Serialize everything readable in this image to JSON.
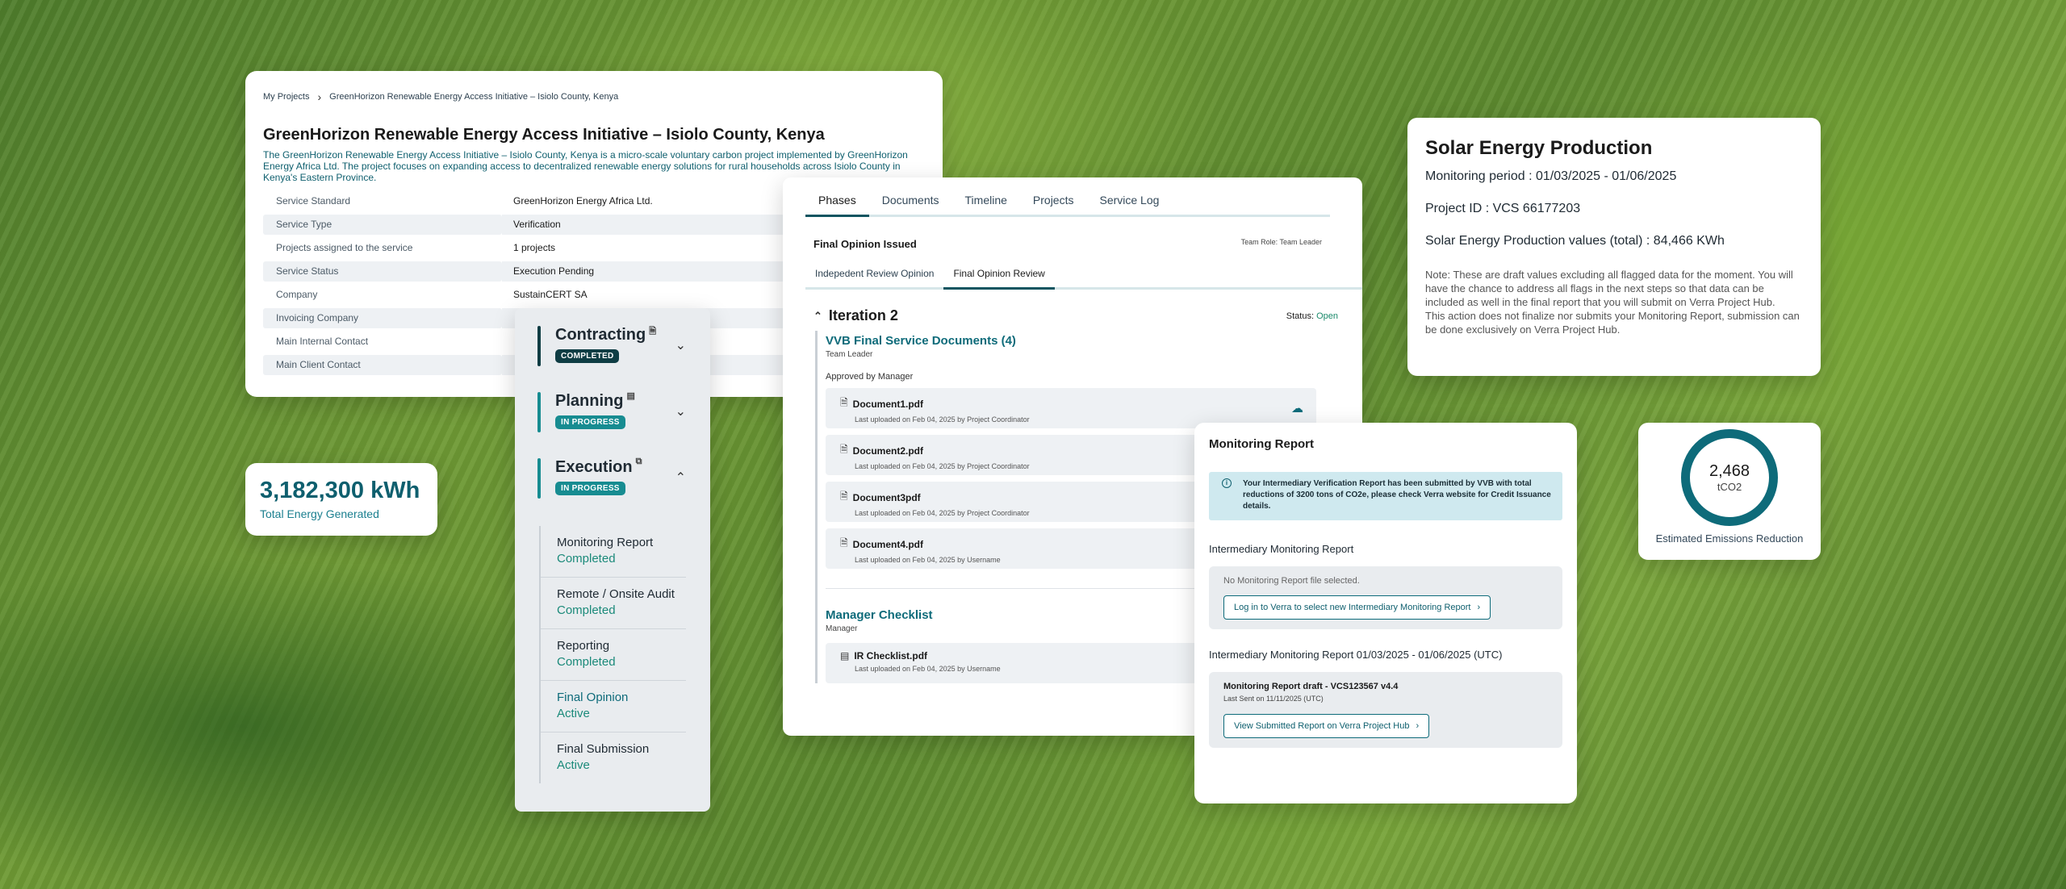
{
  "project": {
    "breadcrumb": [
      "My Projects",
      "GreenHorizon Renewable Energy Access Initiative – Isiolo County, Kenya"
    ],
    "title": "GreenHorizon Renewable Energy Access Initiative – Isiolo County, Kenya",
    "description": "The GreenHorizon Renewable Energy Access Initiative – Isiolo County, Kenya is a micro-scale voluntary carbon project implemented by GreenHorizon Energy Africa Ltd. The project focuses on expanding access to decentralized renewable energy solutions for rural households across Isiolo County in Kenya's Eastern Province.",
    "rows": [
      {
        "k": "Service Standard",
        "v": "GreenHorizon Energy Africa Ltd."
      },
      {
        "k": "Service Type",
        "v": "Verification"
      },
      {
        "k": "Projects assigned to the service",
        "v": "1 projects"
      },
      {
        "k": "Service Status",
        "v": "Execution Pending"
      },
      {
        "k": "Company",
        "v": "SustainCERT SA"
      },
      {
        "k": "Invoicing Company",
        "v": ""
      },
      {
        "k": "Main Internal Contact",
        "v": ""
      },
      {
        "k": "Main Client Contact",
        "v": ""
      }
    ]
  },
  "energy": {
    "value": "3,182,300 kWh",
    "label": "Total Energy Generated"
  },
  "phases": {
    "contracting": {
      "name": "Contracting",
      "badge": "COMPLETED"
    },
    "planning": {
      "name": "Planning",
      "badge": "IN PROGRESS"
    },
    "execution": {
      "name": "Execution",
      "badge": "IN PROGRESS"
    },
    "steps": [
      {
        "t": "Monitoring Report",
        "s": "Completed"
      },
      {
        "t": "Remote / Onsite Audit",
        "s": "Completed"
      },
      {
        "t": "Reporting",
        "s": "Completed"
      },
      {
        "t": "Final Opinion",
        "s": "Active"
      },
      {
        "t": "Final Submission",
        "s": "Active"
      }
    ]
  },
  "service": {
    "tabs": [
      "Phases",
      "Documents",
      "Timeline",
      "Projects",
      "Service Log"
    ],
    "final_opinion": "Final Opinion Issued",
    "team_role": "Team Role: Team Leader",
    "subtabs": [
      "Indepedent Review Opinion",
      "Final Opinion Review"
    ],
    "iteration": "Iteration 2",
    "status_label": "Status:",
    "status_value": "Open",
    "vvb_title": "VVB Final Service Documents (4)",
    "vvb_role": "Team Leader",
    "approved": "Approved by Manager",
    "docs": [
      {
        "n": "Document1.pdf",
        "u": "Last uploaded on Feb 04, 2025 by Project Coordinator"
      },
      {
        "n": "Document2.pdf",
        "u": "Last uploaded on Feb 04, 2025 by Project Coordinator"
      },
      {
        "n": "Document3pdf",
        "u": "Last uploaded on Feb 04, 2025 by Project Coordinator"
      },
      {
        "n": "Document4.pdf",
        "u": "Last uploaded on Feb 04, 2025 by Username"
      }
    ],
    "checklist_title": "Manager Checklist",
    "checklist_role": "Manager",
    "checklist_doc": {
      "n": "IR Checklist.pdf",
      "u": "Last uploaded on Feb 04, 2025 by Username"
    }
  },
  "solar": {
    "title": "Solar Energy Production",
    "period": "Monitoring period : 01/03/2025 - 01/06/2025",
    "project_id": "Project ID : VCS 66177203",
    "values": "Solar Energy Production values (total) : 84,466 KWh",
    "note": "Note: These are draft values excluding all flagged data for the moment. You will have the chance to address all flags in the next steps so that data can be included as well in the final report that you will submit on Verra Project Hub.",
    "note2": "This action does not finalize nor submits your Monitoring Report, submission can be done exclusively on Verra Project Hub."
  },
  "monitoring": {
    "title": "Monitoring Report",
    "info": "Your Intermediary Verification Report has been submitted by VVB with total reductions of 3200 tons of CO2e, please check Verra website for Credit Issuance details.",
    "imr_heading": "Intermediary Monitoring Report",
    "no_file": "No Monitoring Report file selected.",
    "login_btn": "Log in to Verra to select new Intermediary Monitoring Report",
    "period_heading": "Intermediary Monitoring Report 01/03/2025 - 01/06/2025 (UTC)",
    "draft_name": "Monitoring Report draft - VCS123567 v4.4",
    "last_sent": "Last Sent on 11/11/2025 (UTC)",
    "view_btn": "View Submitted Report on Verra Project Hub"
  },
  "emissions": {
    "value": "2,468",
    "unit": "tCO2",
    "label": "Estimated Emissions Reduction"
  },
  "icons": [
    "chevron-right-icon",
    "document-icon",
    "chevron-down-icon",
    "chevron-up-icon",
    "file-icon",
    "cloud-upload-icon",
    "info-icon"
  ],
  "colors": {
    "accent": "#0e6b7a",
    "success": "#1b8a6b",
    "dark_badge": "#0f3d44"
  }
}
